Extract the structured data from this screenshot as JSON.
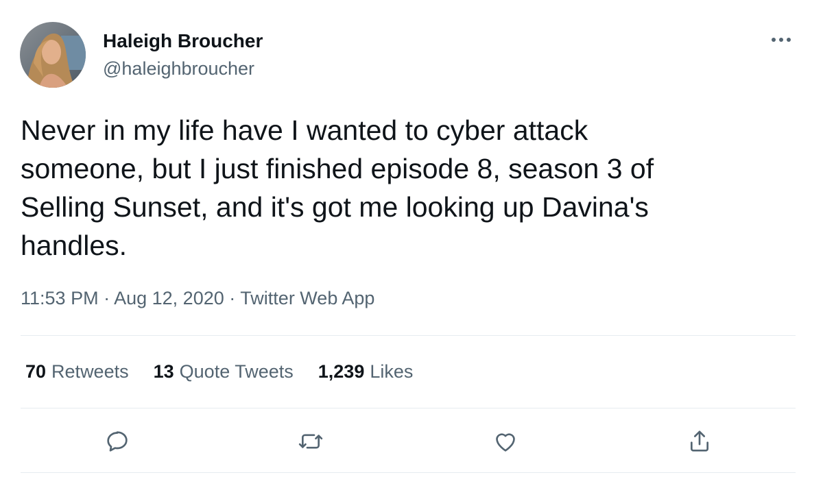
{
  "author": {
    "name": "Haleigh Broucher",
    "handle": "@haleighbroucher"
  },
  "more_icon": "more-horizontal-icon",
  "tweet_text": "Never in my life have I wanted to cyber attack\nsomeone, but I just finished episode 8, season 3 of\nSelling Sunset, and it's got me looking up Davina's\nhandles.",
  "meta": {
    "time": "11:53 PM",
    "separator": "·",
    "date": "Aug 12, 2020",
    "source": "Twitter Web App"
  },
  "stats": {
    "retweets": {
      "count": "70",
      "label": "Retweets"
    },
    "quotes": {
      "count": "13",
      "label": "Quote Tweets"
    },
    "likes": {
      "count": "1,239",
      "label": "Likes"
    }
  },
  "actions": {
    "reply": "reply-icon",
    "retweet": "retweet-icon",
    "like": "heart-icon",
    "share": "share-icon"
  },
  "colors": {
    "text": "#0f1419",
    "muted": "#536471",
    "divider": "#e6ecf0",
    "icon": "#536471"
  }
}
